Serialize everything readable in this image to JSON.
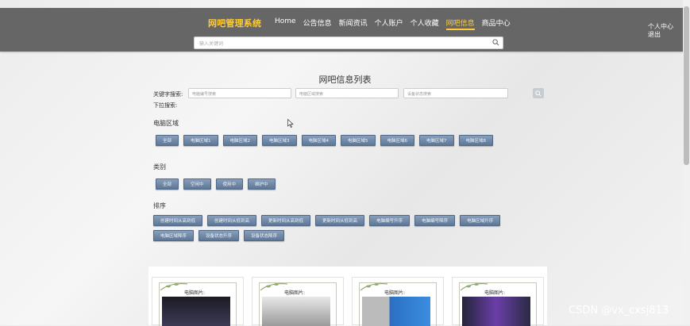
{
  "header": {
    "brand": "网吧管理系统",
    "nav": [
      "Home",
      "公告信息",
      "新闻资讯",
      "个人账户",
      "个人收藏",
      "网吧信息",
      "商品中心"
    ],
    "active_nav_index": 5,
    "search_placeholder": "输入关键词",
    "user_menu": [
      "个人中心",
      "退出"
    ]
  },
  "main": {
    "title": "网吧信息列表",
    "keyword_label": "关键字搜索:",
    "dropdown_label": "下拉搜索:",
    "filters": [
      {
        "placeholder": "电脑编号搜索"
      },
      {
        "placeholder": "电脑区域搜索"
      },
      {
        "placeholder": "设备状态搜索"
      }
    ],
    "sections": [
      {
        "title": "电脑区域",
        "chips": [
          "全部",
          "电脑区域1",
          "电脑区域2",
          "电脑区域3",
          "电脑区域4",
          "电脑区域5",
          "电脑区域6",
          "电脑区域7",
          "电脑区域8"
        ]
      },
      {
        "title": "类别",
        "chips": [
          "全部",
          "空闲中",
          "使用中",
          "维护中"
        ]
      },
      {
        "title": "排序",
        "chips": [
          "创建时间从高到低",
          "创建时间从低到高",
          "更新时间从高到低",
          "更新时间从低到高",
          "电脑编号升序",
          "电脑编号降序",
          "电脑区域升序",
          "电脑区域降序",
          "设备状态升序",
          "设备状态降序"
        ]
      }
    ],
    "card_label": "电脑图片:"
  },
  "watermark": "CSDN @vx_cxsj813"
}
